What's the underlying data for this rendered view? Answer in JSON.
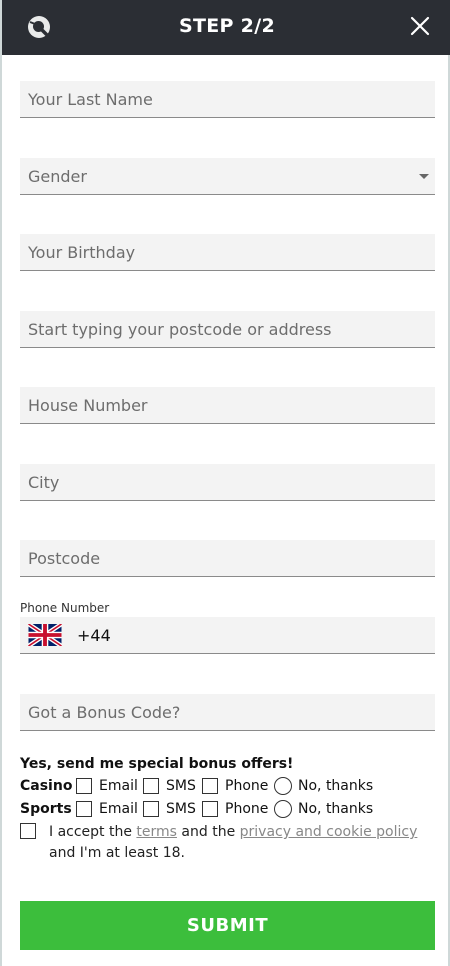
{
  "header": {
    "title": "STEP 2/2",
    "logo_icon": "brand-logo-icon",
    "close_icon": "close-icon",
    "background": "#2b2e34"
  },
  "form": {
    "last_name_placeholder": "Your Last Name",
    "gender_placeholder": "Gender",
    "birthday_placeholder": "Your Birthday",
    "address_placeholder": "Start typing your postcode or address",
    "house_number_placeholder": "House Number",
    "city_placeholder": "City",
    "postcode_placeholder": "Postcode",
    "phone_label": "Phone Number",
    "phone_country_flag": "uk-flag-icon",
    "phone_dial_code": "+44",
    "bonus_code_placeholder": "Got a Bonus Code?"
  },
  "offers": {
    "title": "Yes, send me special bonus offers!",
    "rows": [
      {
        "label": "Casino",
        "options": [
          "Email",
          "SMS",
          "Phone"
        ],
        "decline": "No, thanks"
      },
      {
        "label": "Sports",
        "options": [
          "Email",
          "SMS",
          "Phone"
        ],
        "decline": "No, thanks"
      }
    ]
  },
  "terms": {
    "prefix": "I accept the",
    "terms_link": "terms",
    "middle": "and the",
    "privacy_link": "privacy and cookie policy",
    "suffix": "and I'm at least 18."
  },
  "submit": {
    "label": "SUBMIT",
    "color": "#3cbe3c"
  }
}
